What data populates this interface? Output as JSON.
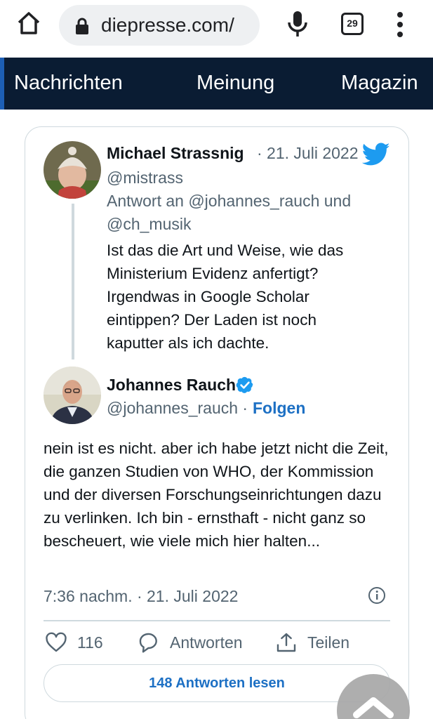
{
  "browser": {
    "url": "diepresse.com/",
    "tab_count": "29"
  },
  "nav": {
    "items": [
      "Nachrichten",
      "Meinung",
      "Magazin"
    ]
  },
  "tweet_reply": {
    "author_name": "Michael Strassnig",
    "date": "· 21. Juli 2022",
    "handle": "@mistrass",
    "reply_to_line1": "Antwort an @johannes_rauch und",
    "reply_to_line2": "@ch_musik",
    "text": "Ist das die Art und Weise, wie das Ministerium Evidenz anfertigt? Irgendwas in Google Scholar eintippen? Der Laden ist noch kaputter als ich dachte."
  },
  "tweet_main": {
    "author_name": "Johannes Rauch",
    "handle": "@johannes_rauch ·",
    "follow_label": "Folgen",
    "text": "nein ist es nicht. aber ich habe jetzt nicht die Zeit, die ganzen Studien von WHO, der Kommission und der diversen Forschungseinrichtungen dazu zu verlinken. Ich bin - ernsthaft - nicht ganz so bescheuert, wie viele mich hier halten...",
    "timestamp": "7:36 nachm. · 21. Juli 2022",
    "likes": "116",
    "reply_label": "Antworten",
    "share_label": "Teilen",
    "read_replies_label": "148 Antworten lesen"
  },
  "colors": {
    "nav_bg": "#0a1c33",
    "twitter_blue": "#1d9bf0",
    "link_blue": "#1d70c4",
    "muted_text": "#536471"
  },
  "icons": [
    "home-icon",
    "lock-icon",
    "mic-icon",
    "tabs-icon",
    "more-vert-icon",
    "twitter-bird-icon",
    "verified-badge-icon",
    "info-icon",
    "heart-icon",
    "reply-icon",
    "share-icon",
    "chevron-up-icon"
  ]
}
